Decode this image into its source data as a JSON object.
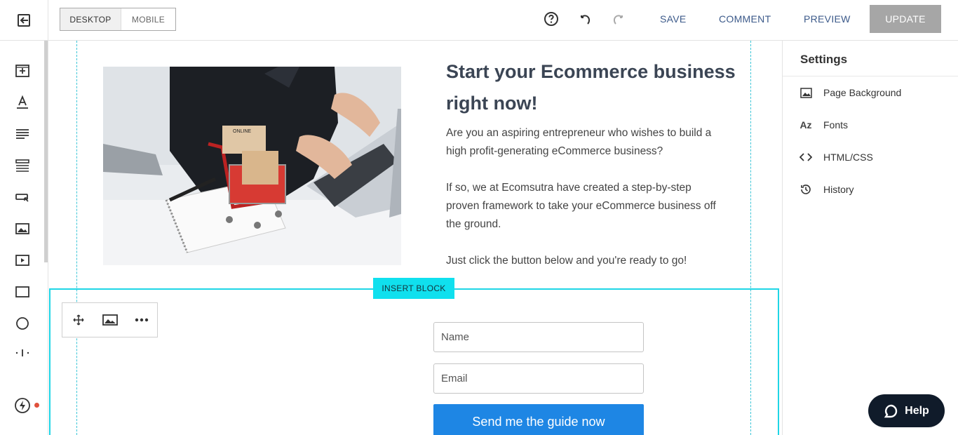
{
  "topbar": {
    "view_toggle": {
      "desktop": "DESKTOP",
      "mobile": "MOBILE"
    },
    "icons": [
      "exit-editor-icon",
      "help-circle-icon",
      "undo-icon",
      "redo-icon"
    ],
    "save": "SAVE",
    "comment": "COMMENT",
    "preview": "PREVIEW",
    "update": "UPDATE"
  },
  "left_tools": [
    "add-section-icon",
    "text-icon",
    "paragraph-icon",
    "list-icon",
    "button-icon",
    "image-icon",
    "video-icon",
    "box-icon",
    "circle-icon",
    "divider-icon",
    "lightning-icon"
  ],
  "canvas": {
    "headline": "Start your Ecommerce business right now!",
    "paragraphs": [
      "Are you an aspiring entrepreneur who wishes to build a high profit-generating eCommerce business?",
      "If so, we at Ecomsutra have created a step-by-step proven framework to take your eCommerce business off the ground.",
      "Just click the button below and you're ready to go!"
    ],
    "image_text": "ONLINE",
    "insert_block": "INSERT BLOCK",
    "form": {
      "name_placeholder": "Name",
      "email_placeholder": "Email",
      "button": "Send me the guide now"
    }
  },
  "settings": {
    "title": "Settings",
    "items": [
      {
        "label": "Page Background",
        "icon": "image-icon"
      },
      {
        "label": "Fonts",
        "icon": "fonts-icon",
        "icon_text": "Az"
      },
      {
        "label": "HTML/CSS",
        "icon": "code-icon"
      },
      {
        "label": "History",
        "icon": "history-icon"
      }
    ]
  },
  "help": {
    "label": "Help"
  },
  "colors": {
    "accent_cyan": "#1fd6e6",
    "cta_blue": "#1e86e4",
    "update_gray": "#a6a6a6",
    "link_blue": "#3c5a8a",
    "help_bg": "#101b2a"
  }
}
